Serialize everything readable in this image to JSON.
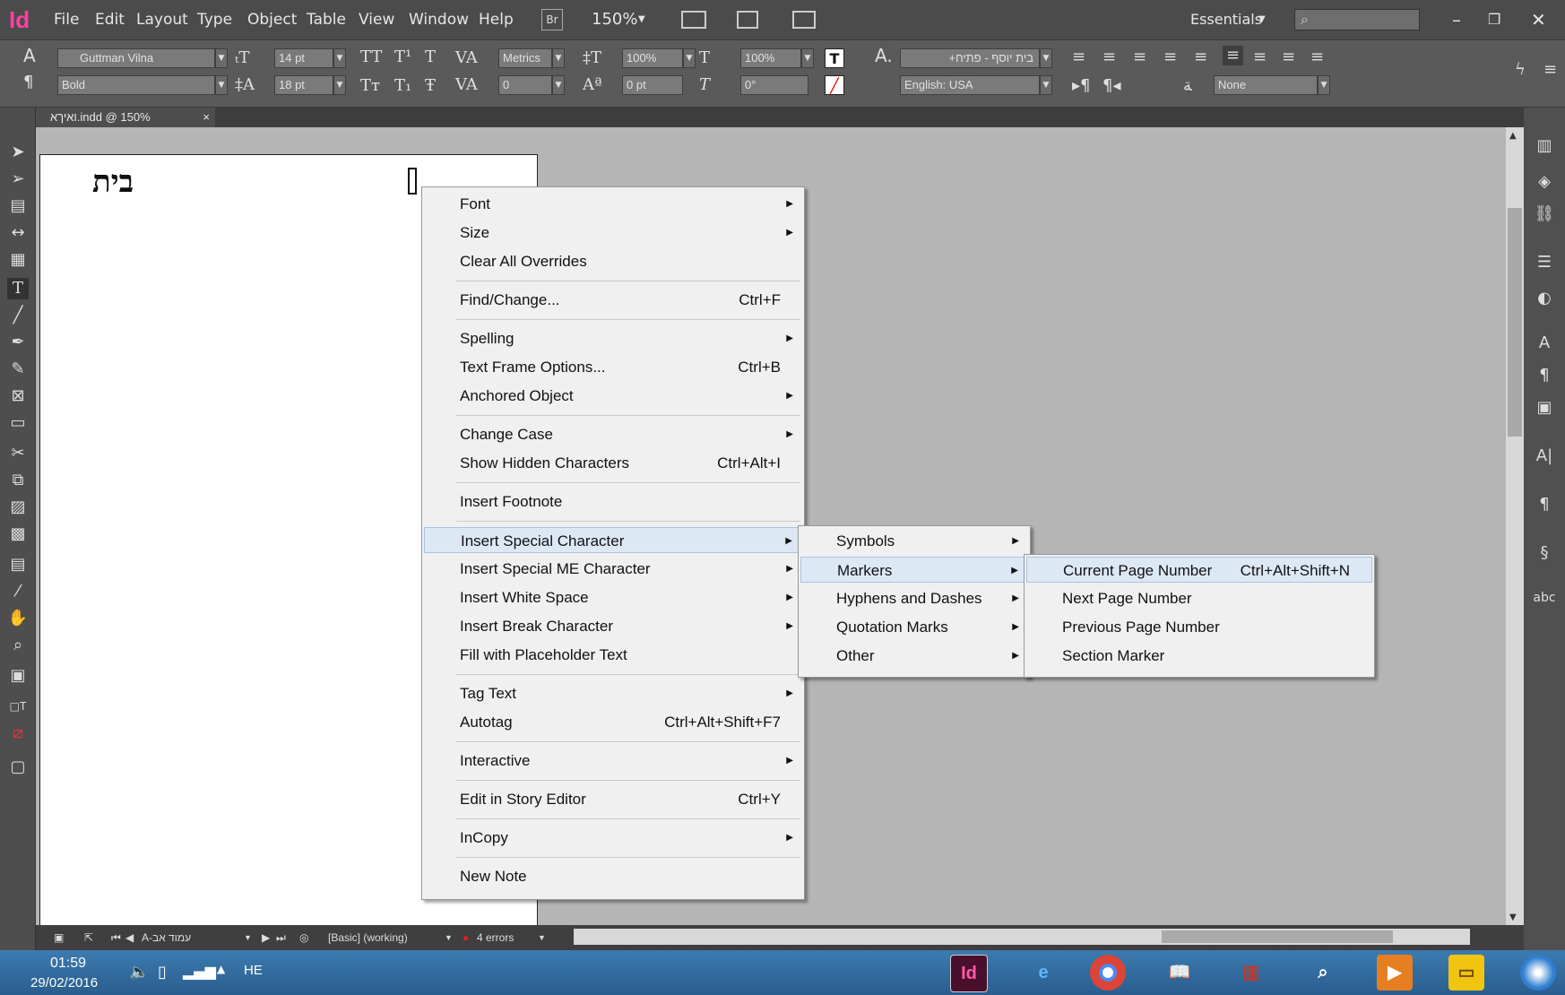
{
  "menubar": {
    "app_logo": "Id",
    "items": [
      "File",
      "Edit",
      "Layout",
      "Type",
      "Object",
      "Table",
      "View",
      "Window",
      "Help"
    ],
    "bridge": "Br",
    "zoom": "150%",
    "workspace": "Essentials"
  },
  "control": {
    "font_family": "Guttman Vilna",
    "font_style": "Bold",
    "font_size": "14 pt",
    "leading": "18 pt",
    "kerning": "Metrics",
    "tracking": "0",
    "vscale": "100%",
    "hscale": "100%",
    "baseline": "0 pt",
    "skew": "0°",
    "char_style": "בית יוסף - פתיח+",
    "language": "English: USA",
    "none_label": "None"
  },
  "document": {
    "tab_title": "א.indd @ 150%",
    "tab_prefix": "ואיך",
    "page_text": "בית"
  },
  "context_menu": {
    "items": [
      {
        "label": "Font",
        "shortcut": "",
        "submenu": true
      },
      {
        "label": "Size",
        "shortcut": "",
        "submenu": true
      },
      {
        "label": "Clear All Overrides",
        "shortcut": "",
        "submenu": false
      },
      {
        "label": "Find/Change...",
        "shortcut": "Ctrl+F",
        "submenu": false
      },
      {
        "label": "Spelling",
        "shortcut": "",
        "submenu": true
      },
      {
        "label": "Text Frame Options...",
        "shortcut": "Ctrl+B",
        "submenu": false
      },
      {
        "label": "Anchored Object",
        "shortcut": "",
        "submenu": true
      },
      {
        "label": "Change Case",
        "shortcut": "",
        "submenu": true
      },
      {
        "label": "Show Hidden Characters",
        "shortcut": "Ctrl+Alt+I",
        "submenu": false
      },
      {
        "label": "Insert Footnote",
        "shortcut": "",
        "submenu": false
      },
      {
        "label": "Insert Special Character",
        "shortcut": "",
        "submenu": true
      },
      {
        "label": "Insert Special ME Character",
        "shortcut": "",
        "submenu": true
      },
      {
        "label": "Insert White Space",
        "shortcut": "",
        "submenu": true
      },
      {
        "label": "Insert Break Character",
        "shortcut": "",
        "submenu": true
      },
      {
        "label": "Fill with Placeholder Text",
        "shortcut": "",
        "submenu": false
      },
      {
        "label": "Tag Text",
        "shortcut": "",
        "submenu": true
      },
      {
        "label": "Autotag",
        "shortcut": "Ctrl+Alt+Shift+F7",
        "submenu": false
      },
      {
        "label": "Interactive",
        "shortcut": "",
        "submenu": true
      },
      {
        "label": "Edit in Story Editor",
        "shortcut": "Ctrl+Y",
        "submenu": false
      },
      {
        "label": "InCopy",
        "shortcut": "",
        "submenu": true
      },
      {
        "label": "New Note",
        "shortcut": "",
        "submenu": false
      }
    ]
  },
  "special_char_menu": {
    "items": [
      {
        "label": "Symbols",
        "submenu": true
      },
      {
        "label": "Markers",
        "submenu": true
      },
      {
        "label": "Hyphens and Dashes",
        "submenu": true
      },
      {
        "label": "Quotation Marks",
        "submenu": true
      },
      {
        "label": "Other",
        "submenu": true
      }
    ]
  },
  "markers_menu": {
    "items": [
      {
        "label": "Current Page Number",
        "shortcut": "Ctrl+Alt+Shift+N"
      },
      {
        "label": "Next Page Number",
        "shortcut": ""
      },
      {
        "label": "Previous Page Number",
        "shortcut": ""
      },
      {
        "label": "Section Marker",
        "shortcut": ""
      }
    ]
  },
  "status": {
    "page": "עמוד אב-A",
    "preflight_profile": "[Basic] (working)",
    "errors": "4 errors"
  },
  "taskbar": {
    "time": "01:59",
    "date": "29/02/2016",
    "lang": "HE"
  }
}
